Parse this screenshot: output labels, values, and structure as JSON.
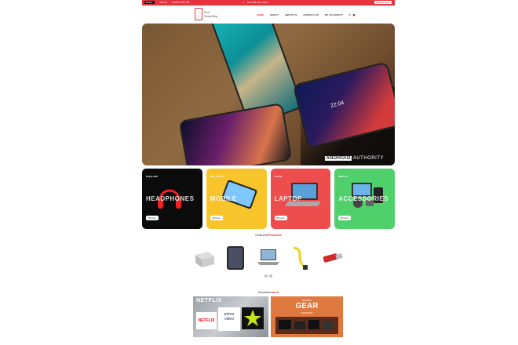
{
  "topbar": {
    "email_label": "Call Us",
    "phone": "+00 567 234 789",
    "offer": "Get Offer Now Now",
    "register": "Register Now",
    "bg": "#e5323c"
  },
  "logo": {
    "line1": "Sell",
    "line2": "SmartBay"
  },
  "nav": {
    "items": [
      "HOME",
      "SHOP",
      "ABOUT US",
      "CONTACT US",
      "MY ACCOUNT"
    ],
    "active": 0
  },
  "hero": {
    "watermark_a": "ANDROID",
    "watermark_b": "AUTHORITY",
    "clock": "22:04"
  },
  "cards": [
    {
      "subtitle": "Enjoy with",
      "title": "HEADPHONES",
      "button": "Browse",
      "color": "#0b0b0b"
    },
    {
      "subtitle": "New Phones",
      "title": "MOBILE",
      "button": "Browse",
      "color": "#f7c52b"
    },
    {
      "subtitle": "Trendy",
      "title": "LAPTOP",
      "button": "Browse",
      "color": "#ee4d4d"
    },
    {
      "subtitle": "Wish for",
      "title": "ACCESSORIES",
      "button": "Browse",
      "color": "#4fd06b"
    }
  ],
  "featured": {
    "prefix": "Featured",
    "highlight": "Products"
  },
  "products": [
    "silver-box-icon",
    "tablet-icon",
    "laptop-icon",
    "cable-icon",
    "usb-drive-icon"
  ],
  "advertisement": {
    "prefix": "Advertise",
    "highlight": "ment"
  },
  "ads": {
    "ad1": {
      "brand": "NETFLIX",
      "logo1": "NETFLIX",
      "logo2_a": "prime",
      "logo2_b": "video"
    },
    "ad2": {
      "line1": "GAMING",
      "line2": "GEAR",
      "line3": "GIVEAWAY"
    }
  },
  "colors": {
    "accent": "#e5323c"
  }
}
